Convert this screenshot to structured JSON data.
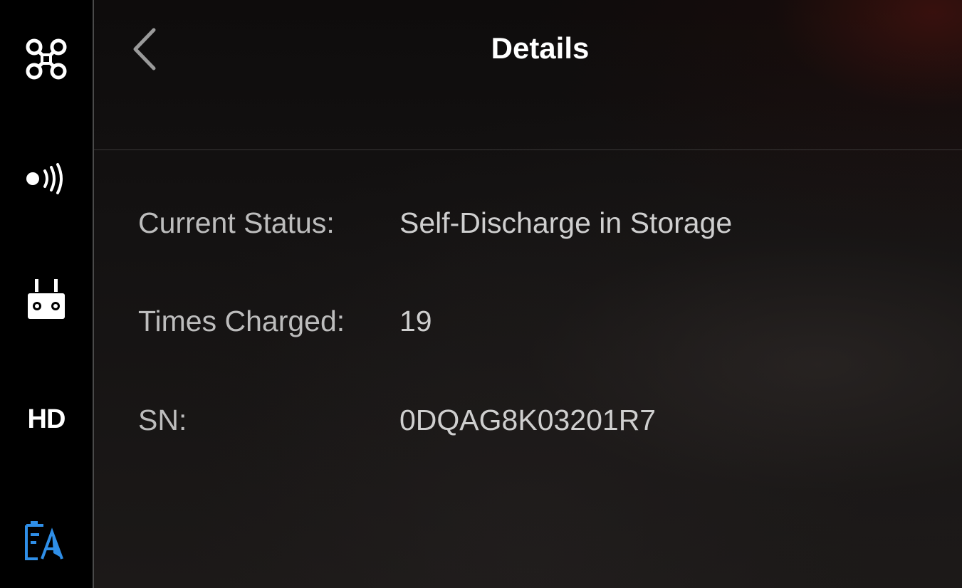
{
  "header": {
    "title": "Details"
  },
  "sidebar": {
    "items": [
      {
        "icon": "drone-icon",
        "label": ""
      },
      {
        "icon": "signal-broadcast-icon",
        "label": ""
      },
      {
        "icon": "remote-controller-icon",
        "label": ""
      },
      {
        "icon": "hd-video-icon",
        "label": "HD"
      },
      {
        "icon": "battery-icon",
        "label": "",
        "active": true
      }
    ],
    "active_color": "#2f8fe8"
  },
  "details": {
    "current_status": {
      "label": "Current Status:",
      "value": "Self-Discharge in Storage"
    },
    "times_charged": {
      "label": "Times Charged:",
      "value": "19"
    },
    "serial_number": {
      "label": "SN:",
      "value": "0DQAG8K03201R7"
    }
  }
}
